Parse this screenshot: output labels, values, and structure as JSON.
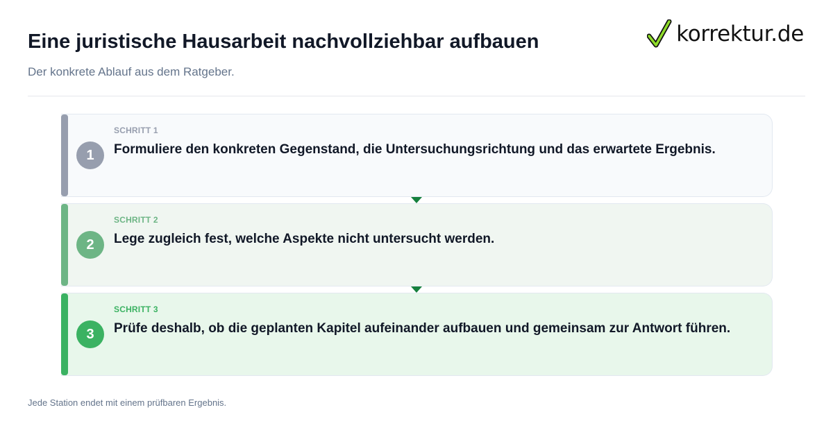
{
  "header": {
    "title": "Eine juristische Hausarbeit nachvollziehbar aufbauen",
    "subtitle": "Der konkrete Ablauf aus dem Ratgeber."
  },
  "logo": {
    "text": "korrektur.de",
    "icon": "checkmark-icon"
  },
  "steps": [
    {
      "number": "1",
      "label": "SCHRITT 1",
      "text": "Formuliere den konkreten Gegenstand, die Untersuchungsrichtung und das erwartete Ergebnis.",
      "color": "#979eae"
    },
    {
      "number": "2",
      "label": "SCHRITT 2",
      "text": "Lege zugleich fest, welche Aspekte nicht untersucht werden.",
      "color": "#6db585"
    },
    {
      "number": "3",
      "label": "SCHRITT 3",
      "text": "Prüfe deshalb, ob die geplanten Kapitel aufeinander aufbauen und gemeinsam zur Antwort führen.",
      "color": "#3bb262"
    }
  ],
  "connector_color": "#15803d",
  "footnote": "Jede Station endet mit einem prüfbaren Ergebnis."
}
